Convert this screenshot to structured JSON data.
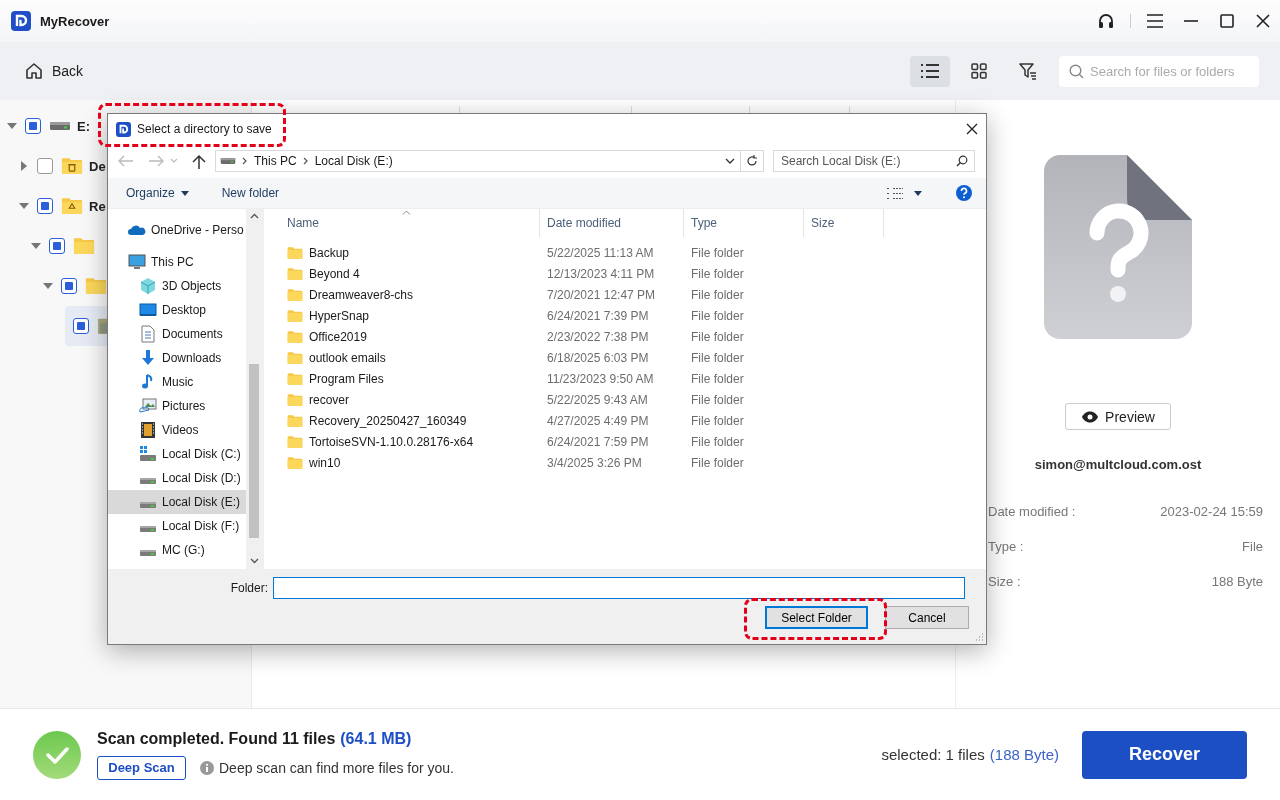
{
  "app": {
    "title": "MyRecover"
  },
  "toolbar": {
    "back": "Back",
    "views": [
      {
        "kind": "list",
        "selected": true
      },
      {
        "kind": "grid",
        "selected": false
      }
    ],
    "search": {
      "placeholder": "Search for files or folders"
    }
  },
  "tree": [
    {
      "label": "E:",
      "kind": "drive",
      "partial": true,
      "expanded": true,
      "selected": false,
      "children": [
        {
          "label": "De",
          "kind": "trash-folder",
          "partial": false,
          "expanded": false,
          "selected": false
        },
        {
          "label": "Re",
          "kind": "recycle-folder",
          "partial": true,
          "expanded": true,
          "selected": false,
          "children": [
            {
              "kind": "folder",
              "partial": true,
              "expanded": true,
              "selected": false,
              "children": [
                {
                  "kind": "folder",
                  "partial": true,
                  "expanded": true,
                  "selected": false,
                  "children": [
                    {
                      "kind": "file-folder",
                      "partial": true,
                      "selected": true
                    }
                  ]
                }
              ]
            }
          ]
        }
      ]
    }
  ],
  "detail": {
    "preview": "Preview",
    "name": "simon@multcloud.com.ost",
    "fields": [
      {
        "label": "Date modified :",
        "value": "2023-02-24 15:59"
      },
      {
        "label": "Type :",
        "value": "File"
      },
      {
        "label": "Size :",
        "value": "188 Byte"
      }
    ]
  },
  "footer": {
    "status": "Scan completed. Found 11 files",
    "size": "(64.1 MB)",
    "deep_scan": "Deep Scan",
    "hint": "Deep scan can find more files for you.",
    "selected": "selected: 1 files",
    "selected_size": "(188 Byte)",
    "recover": "Recover"
  },
  "dialog": {
    "title": "Select a directory to save",
    "title_highlighted": true,
    "path": [
      "This PC",
      "Local Disk (E:)"
    ],
    "search": {
      "placeholder": "Search Local Disk (E:)"
    },
    "commands": [
      {
        "label": "Organize",
        "kind": "menu"
      },
      {
        "label": "New folder",
        "kind": "plain"
      }
    ],
    "nav": [
      {
        "label": "OneDrive - Perso",
        "kind": "onedrive",
        "selected": false
      },
      {
        "label": "This PC",
        "kind": "pc",
        "selected": false,
        "children": [
          {
            "label": "3D Objects",
            "kind": "cube",
            "selected": false
          },
          {
            "label": "Desktop",
            "kind": "desktop",
            "selected": false
          },
          {
            "label": "Documents",
            "kind": "documents",
            "selected": false
          },
          {
            "label": "Downloads",
            "kind": "downloads",
            "selected": false
          },
          {
            "label": "Music",
            "kind": "music",
            "selected": false
          },
          {
            "label": "Pictures",
            "kind": "pictures",
            "selected": false
          },
          {
            "label": "Videos",
            "kind": "videos",
            "selected": false
          },
          {
            "label": "Local Disk (C:)",
            "kind": "system-drive",
            "selected": false
          },
          {
            "label": "Local Disk (D:)",
            "kind": "drive",
            "selected": false
          },
          {
            "label": "Local Disk (E:)",
            "kind": "drive",
            "selected": true
          },
          {
            "label": "Local Disk (F:)",
            "kind": "drive",
            "selected": false
          },
          {
            "label": "MC (G:)",
            "kind": "drive",
            "selected": false
          }
        ]
      }
    ],
    "columns": [
      "Name",
      "Date modified",
      "Type",
      "Size"
    ],
    "rows": [
      {
        "name": "Backup",
        "date": "5/22/2025 11:13 AM",
        "type": "File folder"
      },
      {
        "name": "Beyond 4",
        "date": "12/13/2023 4:11 PM",
        "type": "File folder"
      },
      {
        "name": "Dreamweaver8-chs",
        "date": "7/20/2021 12:47 PM",
        "type": "File folder"
      },
      {
        "name": "HyperSnap",
        "date": "6/24/2021 7:39 PM",
        "type": "File folder"
      },
      {
        "name": "Office2019",
        "date": "2/23/2022 7:38 PM",
        "type": "File folder"
      },
      {
        "name": "outlook emails",
        "date": "6/18/2025 6:03 PM",
        "type": "File folder"
      },
      {
        "name": "Program Files",
        "date": "11/23/2023 9:50 AM",
        "type": "File folder"
      },
      {
        "name": "recover",
        "date": "5/22/2025 9:43 AM",
        "type": "File folder"
      },
      {
        "name": "Recovery_20250427_160349",
        "date": "4/27/2025 4:49 PM",
        "type": "File folder"
      },
      {
        "name": "TortoiseSVN-1.10.0.28176-x64",
        "date": "6/24/2021 7:59 PM",
        "type": "File folder"
      },
      {
        "name": "win10",
        "date": "3/4/2025 3:26 PM",
        "type": "File folder"
      }
    ],
    "folder_label": "Folder:",
    "buttons": [
      {
        "label": "Select Folder",
        "kind": "default",
        "highlighted": true
      },
      {
        "label": "Cancel",
        "kind": "plain",
        "highlighted": false
      }
    ]
  }
}
